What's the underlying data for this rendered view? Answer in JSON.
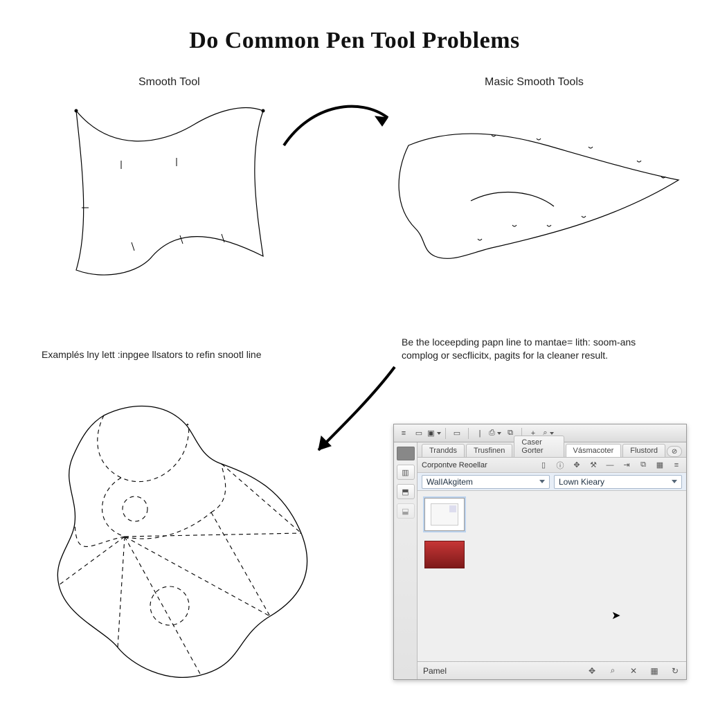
{
  "title": "Do Common Pen Tool Problems",
  "subheads": {
    "left": "Smooth Tool",
    "right": "Masic Smooth Tools"
  },
  "captions": {
    "bottom_left": "Examplés lny lett :inpgee llsators to refin snootl line",
    "bottom_right": "Be the loceepding papn line to mantae= lith: soom-ans complog or secflicitx, pagits for la cleaner result."
  },
  "panel": {
    "tabs": [
      "Trandds",
      "Trusfinen",
      "Caser Gorter",
      "Vásmacoter",
      "Flustord"
    ],
    "active_tab_index": 3,
    "subbar_label": "Corpontve Reoellar",
    "dropdowns": {
      "left_label": "WalIAkgitem",
      "right_label": "Lown Kieary"
    },
    "footer_label": "Pamel",
    "swatch_color": "#a02626"
  },
  "icons": {
    "menu": "≡",
    "doc": "▭",
    "image": "▣",
    "chevron": "▾",
    "plus": "+",
    "search": "⌕",
    "close": "⊘",
    "target": "✥",
    "delete": "✕",
    "grid": "▦",
    "refresh": "↻",
    "cursor": "↖"
  }
}
